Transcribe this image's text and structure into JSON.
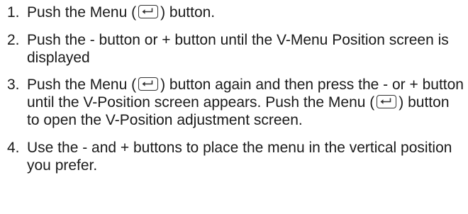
{
  "steps": [
    {
      "number": "1.",
      "parts": [
        "Push the Menu (",
        ") button."
      ]
    },
    {
      "number": "2.",
      "text": "Push the - button or + button until the V-Menu Position screen is displayed"
    },
    {
      "number": "3.",
      "parts": [
        "Push the Menu (",
        ") button again and then press the - or + button until the V-Position screen appears. Push the Menu (",
        ") button to open the V-Position adjustment screen."
      ]
    },
    {
      "number": "4.",
      "text": "Use the - and + buttons to place the menu in the vertical position you prefer."
    }
  ],
  "icons": {
    "menu_button": "enter-arrow-icon"
  }
}
